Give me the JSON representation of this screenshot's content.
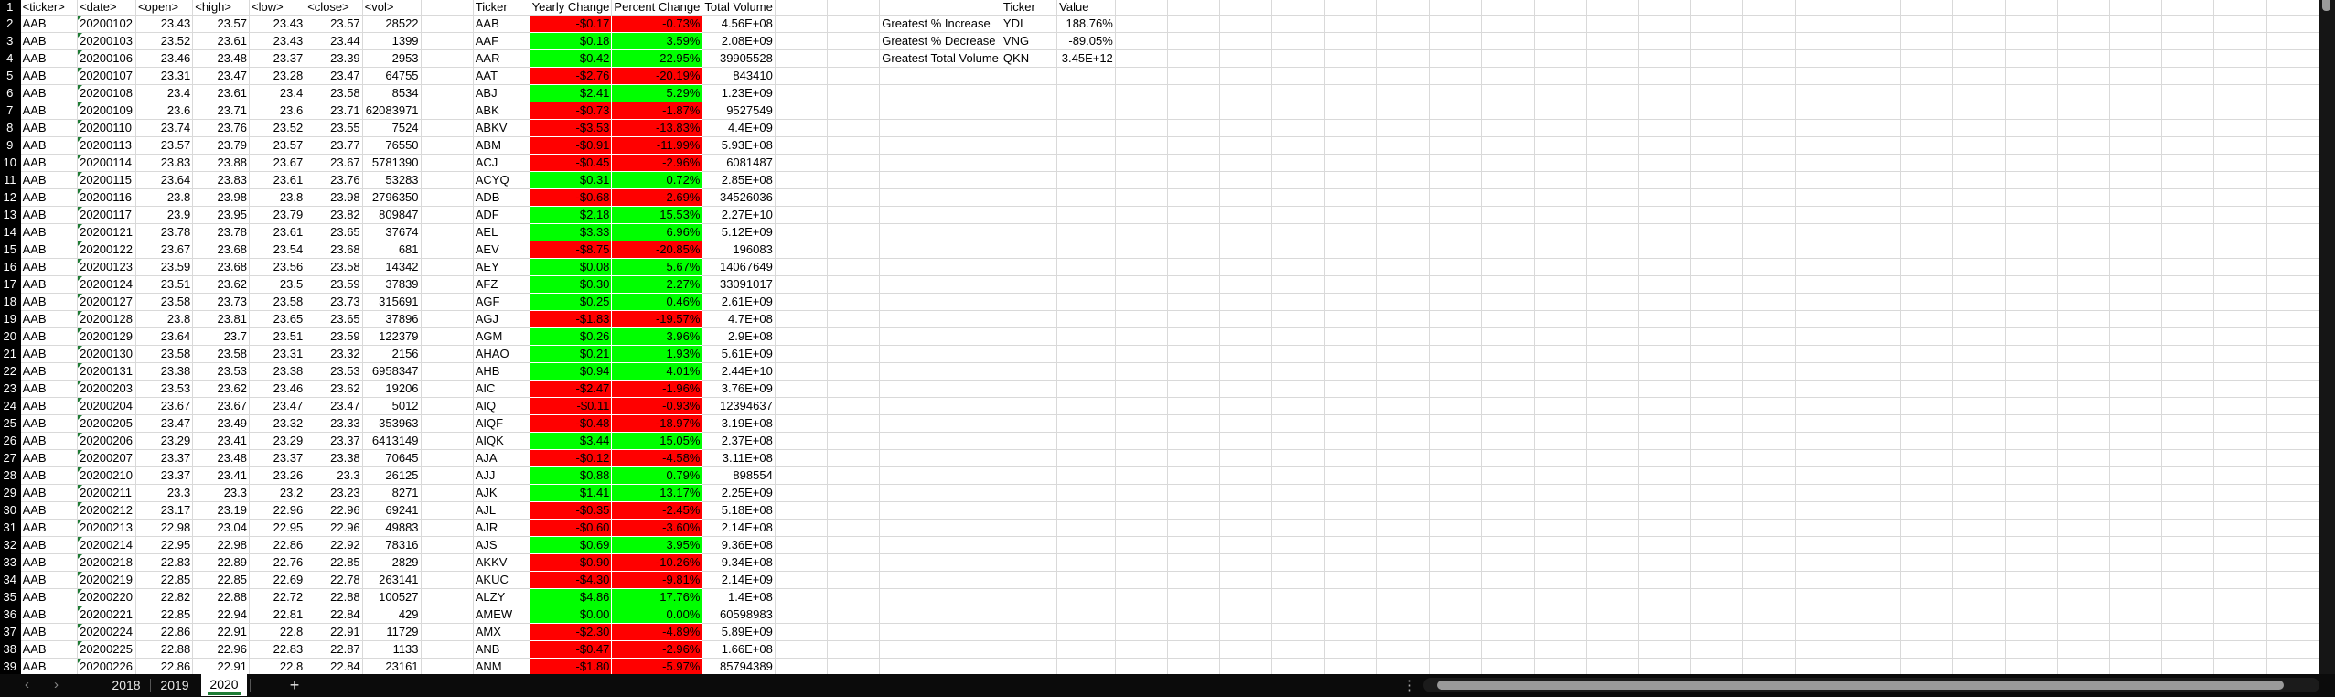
{
  "sheet": {
    "headers": [
      "<ticker>",
      "<date>",
      "<open>",
      "<high>",
      "<low>",
      "<close>",
      "<vol>"
    ],
    "rows": [
      [
        "AAB",
        "20200102",
        "23.43",
        "23.57",
        "23.43",
        "23.57",
        "28522"
      ],
      [
        "AAB",
        "20200103",
        "23.52",
        "23.61",
        "23.43",
        "23.44",
        "1399"
      ],
      [
        "AAB",
        "20200106",
        "23.46",
        "23.48",
        "23.37",
        "23.39",
        "2953"
      ],
      [
        "AAB",
        "20200107",
        "23.31",
        "23.47",
        "23.28",
        "23.47",
        "64755"
      ],
      [
        "AAB",
        "20200108",
        "23.4",
        "23.61",
        "23.4",
        "23.58",
        "8534"
      ],
      [
        "AAB",
        "20200109",
        "23.6",
        "23.71",
        "23.6",
        "23.71",
        "62083971"
      ],
      [
        "AAB",
        "20200110",
        "23.74",
        "23.76",
        "23.52",
        "23.55",
        "7524"
      ],
      [
        "AAB",
        "20200113",
        "23.57",
        "23.79",
        "23.57",
        "23.77",
        "76550"
      ],
      [
        "AAB",
        "20200114",
        "23.83",
        "23.88",
        "23.67",
        "23.67",
        "5781390"
      ],
      [
        "AAB",
        "20200115",
        "23.64",
        "23.83",
        "23.61",
        "23.76",
        "53283"
      ],
      [
        "AAB",
        "20200116",
        "23.8",
        "23.98",
        "23.8",
        "23.98",
        "2796350"
      ],
      [
        "AAB",
        "20200117",
        "23.9",
        "23.95",
        "23.79",
        "23.82",
        "809847"
      ],
      [
        "AAB",
        "20200121",
        "23.78",
        "23.78",
        "23.61",
        "23.65",
        "37674"
      ],
      [
        "AAB",
        "20200122",
        "23.67",
        "23.68",
        "23.54",
        "23.68",
        "681"
      ],
      [
        "AAB",
        "20200123",
        "23.59",
        "23.68",
        "23.56",
        "23.58",
        "14342"
      ],
      [
        "AAB",
        "20200124",
        "23.51",
        "23.62",
        "23.5",
        "23.59",
        "37839"
      ],
      [
        "AAB",
        "20200127",
        "23.58",
        "23.73",
        "23.58",
        "23.73",
        "315691"
      ],
      [
        "AAB",
        "20200128",
        "23.8",
        "23.81",
        "23.65",
        "23.65",
        "37896"
      ],
      [
        "AAB",
        "20200129",
        "23.64",
        "23.7",
        "23.51",
        "23.59",
        "122379"
      ],
      [
        "AAB",
        "20200130",
        "23.58",
        "23.58",
        "23.31",
        "23.32",
        "2156"
      ],
      [
        "AAB",
        "20200131",
        "23.38",
        "23.53",
        "23.38",
        "23.53",
        "6958347"
      ],
      [
        "AAB",
        "20200203",
        "23.53",
        "23.62",
        "23.46",
        "23.62",
        "19206"
      ],
      [
        "AAB",
        "20200204",
        "23.67",
        "23.67",
        "23.47",
        "23.47",
        "5012"
      ],
      [
        "AAB",
        "20200205",
        "23.47",
        "23.49",
        "23.32",
        "23.33",
        "353963"
      ],
      [
        "AAB",
        "20200206",
        "23.29",
        "23.41",
        "23.29",
        "23.37",
        "6413149"
      ],
      [
        "AAB",
        "20200207",
        "23.37",
        "23.48",
        "23.37",
        "23.38",
        "70645"
      ],
      [
        "AAB",
        "20200210",
        "23.37",
        "23.41",
        "23.26",
        "23.3",
        "26125"
      ],
      [
        "AAB",
        "20200211",
        "23.3",
        "23.3",
        "23.2",
        "23.23",
        "8271"
      ],
      [
        "AAB",
        "20200212",
        "23.17",
        "23.19",
        "22.96",
        "22.96",
        "69241"
      ],
      [
        "AAB",
        "20200213",
        "22.98",
        "23.04",
        "22.95",
        "22.96",
        "49883"
      ],
      [
        "AAB",
        "20200214",
        "22.95",
        "22.98",
        "22.86",
        "22.92",
        "78316"
      ],
      [
        "AAB",
        "20200218",
        "22.83",
        "22.89",
        "22.76",
        "22.85",
        "2829"
      ],
      [
        "AAB",
        "20200219",
        "22.85",
        "22.85",
        "22.69",
        "22.78",
        "263141"
      ],
      [
        "AAB",
        "20200220",
        "22.82",
        "22.88",
        "22.72",
        "22.88",
        "100527"
      ],
      [
        "AAB",
        "20200221",
        "22.85",
        "22.94",
        "22.81",
        "22.84",
        "429"
      ],
      [
        "AAB",
        "20200224",
        "22.86",
        "22.91",
        "22.8",
        "22.91",
        "11729"
      ],
      [
        "AAB",
        "20200225",
        "22.88",
        "22.96",
        "22.83",
        "22.87",
        "1133"
      ],
      [
        "AAB",
        "20200226",
        "22.86",
        "22.91",
        "22.8",
        "22.84",
        "23161"
      ]
    ]
  },
  "summary": {
    "headers": [
      "Ticker",
      "Yearly Change",
      "Percent Change",
      "Total Volume"
    ],
    "rows": [
      [
        "AAB",
        "-$0.17",
        "-0.73%",
        "4.56E+08"
      ],
      [
        "AAF",
        "$0.18",
        "3.59%",
        "2.08E+09"
      ],
      [
        "AAR",
        "$0.42",
        "22.95%",
        "39905528"
      ],
      [
        "AAT",
        "-$2.76",
        "-20.19%",
        "843410"
      ],
      [
        "ABJ",
        "$2.41",
        "5.29%",
        "1.23E+09"
      ],
      [
        "ABK",
        "-$0.73",
        "-1.87%",
        "9527549"
      ],
      [
        "ABKV",
        "-$3.53",
        "-13.83%",
        "4.4E+09"
      ],
      [
        "ABM",
        "-$0.91",
        "-11.99%",
        "5.93E+08"
      ],
      [
        "ACJ",
        "-$0.45",
        "-2.96%",
        "6081487"
      ],
      [
        "ACYQ",
        "$0.31",
        "0.72%",
        "2.85E+08"
      ],
      [
        "ADB",
        "-$0.68",
        "-2.69%",
        "34526036"
      ],
      [
        "ADF",
        "$2.18",
        "15.53%",
        "2.27E+10"
      ],
      [
        "AEL",
        "$3.33",
        "6.96%",
        "5.12E+09"
      ],
      [
        "AEV",
        "-$8.75",
        "-20.85%",
        "196083"
      ],
      [
        "AEY",
        "$0.08",
        "5.67%",
        "14067649"
      ],
      [
        "AFZ",
        "$0.30",
        "2.27%",
        "33091017"
      ],
      [
        "AGF",
        "$0.25",
        "0.46%",
        "2.61E+09"
      ],
      [
        "AGJ",
        "-$1.83",
        "-19.57%",
        "4.7E+08"
      ],
      [
        "AGM",
        "$0.26",
        "3.96%",
        "2.9E+08"
      ],
      [
        "AHAO",
        "$0.21",
        "1.93%",
        "5.61E+09"
      ],
      [
        "AHB",
        "$0.94",
        "4.01%",
        "2.44E+10"
      ],
      [
        "AIC",
        "-$2.47",
        "-1.96%",
        "3.76E+09"
      ],
      [
        "AIQ",
        "-$0.11",
        "-0.93%",
        "12394637"
      ],
      [
        "AIQF",
        "-$0.48",
        "-18.97%",
        "3.19E+08"
      ],
      [
        "AIQK",
        "$3.44",
        "15.05%",
        "2.37E+08"
      ],
      [
        "AJA",
        "-$0.12",
        "-4.58%",
        "3.11E+08"
      ],
      [
        "AJJ",
        "$0.88",
        "0.79%",
        "898554"
      ],
      [
        "AJK",
        "$1.41",
        "13.17%",
        "2.25E+09"
      ],
      [
        "AJL",
        "-$0.35",
        "-2.45%",
        "5.18E+08"
      ],
      [
        "AJR",
        "-$0.60",
        "-3.60%",
        "2.14E+08"
      ],
      [
        "AJS",
        "$0.69",
        "3.95%",
        "9.36E+08"
      ],
      [
        "AKKV",
        "-$0.90",
        "-10.26%",
        "9.34E+08"
      ],
      [
        "AKUC",
        "-$4.30",
        "-9.81%",
        "2.14E+09"
      ],
      [
        "ALZY",
        "$4.86",
        "17.76%",
        "1.4E+08"
      ],
      [
        "AMEW",
        "$0.00",
        "0.00%",
        "60598983"
      ],
      [
        "AMX",
        "-$2.30",
        "-4.89%",
        "5.89E+09"
      ],
      [
        "ANB",
        "-$0.47",
        "-2.96%",
        "1.66E+08"
      ],
      [
        "ANM",
        "-$1.80",
        "-5.97%",
        "85794389"
      ]
    ]
  },
  "greatest": {
    "headers": [
      "",
      "Ticker",
      "Value"
    ],
    "rows": [
      [
        "Greatest % Increase",
        "YDI",
        "188.76%"
      ],
      [
        "Greatest % Decrease",
        "VNG",
        "-89.05%"
      ],
      [
        "Greatest Total Volume",
        "QKN",
        "3.45E+12"
      ]
    ]
  },
  "colors": {
    "positive": "#00FF00",
    "negative": "#FF0000",
    "active_tab_underline": "#1E7B34"
  },
  "tabs": {
    "prev_icon": "‹",
    "next_icon": "›",
    "items": [
      "2018",
      "2019",
      "2020"
    ],
    "active": "2020",
    "add_icon": "+",
    "more_icon": "⋮"
  }
}
